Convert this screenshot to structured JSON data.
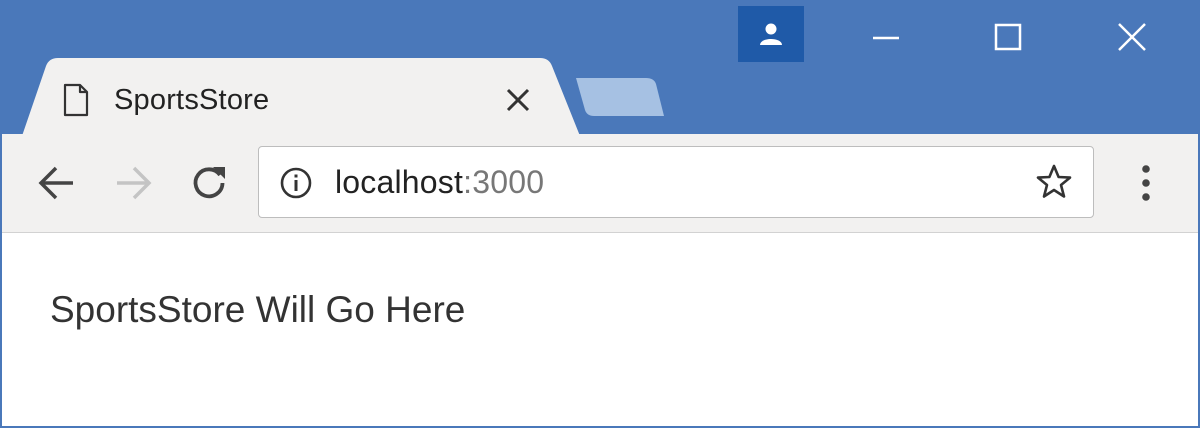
{
  "window": {
    "controls": {
      "profile_icon": "person-icon",
      "minimize_icon": "minimize-icon",
      "maximize_icon": "maximize-icon",
      "close_icon": "close-icon"
    },
    "colors": {
      "titlebar": "#4a78ba",
      "profile_button": "#1f5aa8",
      "toolbar": "#f2f1f0"
    }
  },
  "tabs": [
    {
      "title": "SportsStore",
      "icon": "page-icon",
      "active": true
    }
  ],
  "new_tab": {
    "icon": "new-tab-icon"
  },
  "toolbar": {
    "back_icon": "arrow-left-icon",
    "forward_icon": "arrow-right-icon",
    "reload_icon": "reload-icon",
    "menu_icon": "more-vert-icon"
  },
  "address_bar": {
    "host": "localhost",
    "port": ":3000",
    "info_icon": "info-icon",
    "bookmark_icon": "star-icon"
  },
  "page": {
    "text": "SportsStore Will Go Here"
  }
}
